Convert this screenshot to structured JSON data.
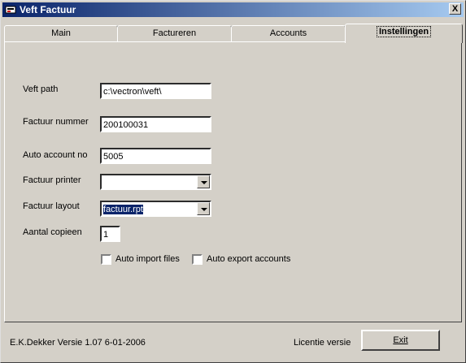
{
  "window": {
    "title": "Veft Factuur",
    "close_label": "X"
  },
  "tabs": [
    {
      "label": "Main"
    },
    {
      "label": "Factureren"
    },
    {
      "label": "Accounts"
    },
    {
      "label": "Instellingen",
      "active": true
    }
  ],
  "settings": {
    "veft_path": {
      "label": "Veft path",
      "value": "c:\\vectron\\veft\\"
    },
    "factuur_nummer": {
      "label": "Factuur nummer",
      "value": "200100031"
    },
    "auto_account": {
      "label": "Auto account no",
      "value": "5005"
    },
    "factuur_printer": {
      "label": "Factuur printer",
      "value": ""
    },
    "factuur_layout": {
      "label": "Factuur layout",
      "value": "factuur.rpt"
    },
    "aantal_copieen": {
      "label": "Aantal copieen",
      "value": "1"
    },
    "auto_import": {
      "label": "Auto import files",
      "checked": false
    },
    "auto_export": {
      "label": "Auto export accounts",
      "checked": false
    }
  },
  "footer": {
    "version_text": "E.K.Dekker  Versie 1.07  6-01-2006",
    "license_text": "Licentie versie",
    "exit_label": "Exit"
  },
  "colors": {
    "titlebar_start": "#0a246a",
    "titlebar_end": "#a6caf0",
    "face": "#d4d0c8"
  }
}
